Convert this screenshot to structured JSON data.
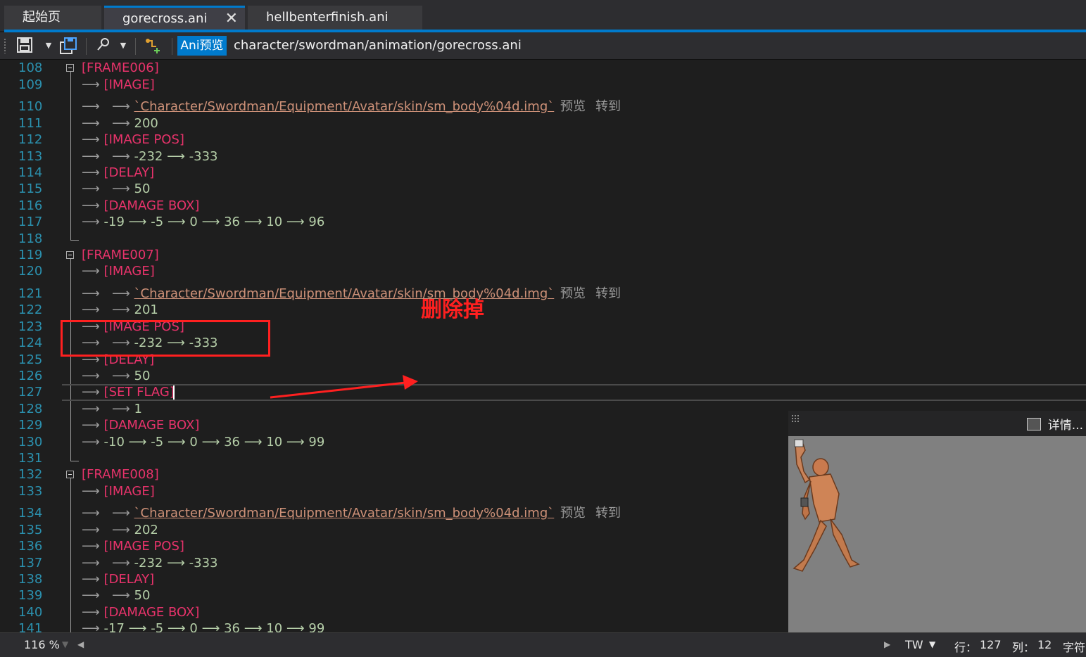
{
  "tabs": [
    {
      "label": "起始页"
    },
    {
      "label": "gorecross.ani",
      "close": "✕"
    },
    {
      "label": "hellbenterfinish.ani"
    }
  ],
  "toolbar": {
    "preview_button": "Ani预览",
    "file_path": "character/swordman/animation/gorecross.ani"
  },
  "editor": {
    "arrow": "⟶",
    "lines": [
      {
        "n": "108",
        "text": "[FRAME006]"
      },
      {
        "n": "109",
        "text": "[IMAGE]"
      },
      {
        "n": "110",
        "text": "`Character/Swordman/Equipment/Avatar/skin/sm_body%04d.img`",
        "actions": [
          "预览",
          "转到"
        ]
      },
      {
        "n": "111",
        "text": "200"
      },
      {
        "n": "112",
        "text": "[IMAGE POS]"
      },
      {
        "n": "113",
        "text": "-232 ⟶ -333"
      },
      {
        "n": "114",
        "text": "[DELAY]"
      },
      {
        "n": "115",
        "text": "50"
      },
      {
        "n": "116",
        "text": "[DAMAGE BOX]"
      },
      {
        "n": "117",
        "text": "-19 ⟶ -5 ⟶ 0 ⟶ 36 ⟶ 10 ⟶ 96"
      },
      {
        "n": "118",
        "text": ""
      },
      {
        "n": "119",
        "text": "[FRAME007]"
      },
      {
        "n": "120",
        "text": "[IMAGE]"
      },
      {
        "n": "121",
        "text": "`Character/Swordman/Equipment/Avatar/skin/sm_body%04d.img`",
        "actions": [
          "预览",
          "转到"
        ]
      },
      {
        "n": "122",
        "text": "201"
      },
      {
        "n": "123",
        "text": "[IMAGE POS]"
      },
      {
        "n": "124",
        "text": "-232 ⟶ -333"
      },
      {
        "n": "125",
        "text": "[DELAY]"
      },
      {
        "n": "126",
        "text": "50"
      },
      {
        "n": "127",
        "text": "[SET FLAG]"
      },
      {
        "n": "128",
        "text": "1"
      },
      {
        "n": "129",
        "text": "[DAMAGE BOX]"
      },
      {
        "n": "130",
        "text": "-10 ⟶ -5 ⟶ 0 ⟶ 36 ⟶ 10 ⟶ 99"
      },
      {
        "n": "131",
        "text": ""
      },
      {
        "n": "132",
        "text": "[FRAME008]"
      },
      {
        "n": "133",
        "text": "[IMAGE]"
      },
      {
        "n": "134",
        "text": "`Character/Swordman/Equipment/Avatar/skin/sm_body%04d.img`",
        "actions": [
          "预览",
          "转到"
        ]
      },
      {
        "n": "135",
        "text": "202"
      },
      {
        "n": "136",
        "text": "[IMAGE POS]"
      },
      {
        "n": "137",
        "text": "-232 ⟶ -333"
      },
      {
        "n": "138",
        "text": "[DELAY]"
      },
      {
        "n": "139",
        "text": "50"
      },
      {
        "n": "140",
        "text": "[DAMAGE BOX]"
      },
      {
        "n": "141",
        "text": "-17 ⟶ -5 ⟶ 0 ⟶ 36 ⟶ 10 ⟶ 99"
      }
    ]
  },
  "annotation": {
    "text": "删除掉",
    "color": "#ff2020"
  },
  "preview_panel": {
    "details": "详情..."
  },
  "status": {
    "zoom": "116 %",
    "encoding": "TW",
    "row_label": "行：",
    "row": "127",
    "col_label": "列：",
    "col": "12",
    "char_label": "字符"
  },
  "colors": {
    "accent": "#007acc",
    "section": "#e8336b",
    "number": "#b5cea8",
    "path": "#ce9178",
    "linenum": "#2b91af"
  }
}
